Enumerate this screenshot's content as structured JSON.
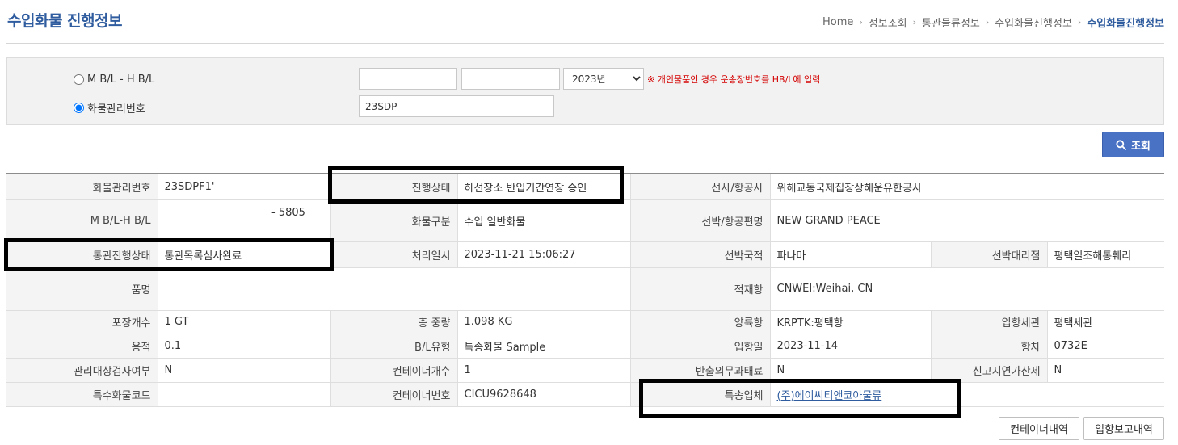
{
  "page": {
    "title": "수입화물 진행정보"
  },
  "breadcrumb": [
    "Home",
    "정보조회",
    "통관물류정보",
    "수입화물진행정보",
    "수입화물진행정보"
  ],
  "search": {
    "radio_mbl_label": "M B/L - H B/L",
    "radio_cargo_label": "화물관리번호",
    "selected": "cargo",
    "mbl_value": "",
    "hbl_value": "",
    "year_selected": "2023년",
    "year_options": [
      "2023년"
    ],
    "notice": "※ 개인물품인 경우 운송장번호를 HB/L에 입력",
    "cargo_value": "23SDP",
    "button_label": "조회"
  },
  "info": {
    "rows": [
      [
        {
          "label": "화물관리번호",
          "value": "23SDPF1'"
        },
        {
          "label": "진행상태",
          "value": "하선장소 반입기간연장 승인"
        },
        {
          "label": "선사/항공사",
          "value": "위해교동국제집장상해운유한공사"
        }
      ],
      [
        {
          "label": "M B/L-H B/L",
          "value": "- 5805"
        },
        {
          "label": "화물구분",
          "value": "수입 일반화물"
        },
        {
          "label": "선박/항공편명",
          "value": "NEW GRAND PEACE"
        }
      ],
      [
        {
          "label": "통관진행상태",
          "value": "통관목록심사완료"
        },
        {
          "label": "처리일시",
          "value": "2023-11-21 15:06:27"
        },
        {
          "label": "선박국적",
          "value": "파나마"
        },
        {
          "label": "선박대리점",
          "value": "평택일조해통훼리"
        }
      ],
      [
        {
          "label": "품명",
          "value": ""
        },
        {
          "label": "적재항",
          "value": "CNWEI:Weihai, CN"
        }
      ],
      [
        {
          "label": "포장개수",
          "value": "1 GT"
        },
        {
          "label": "총 중량",
          "value": "1.098 KG"
        },
        {
          "label": "양륙항",
          "value": "KRPTK:평택항"
        },
        {
          "label": "입항세관",
          "value": "평택세관"
        }
      ],
      [
        {
          "label": "용적",
          "value": "0.1"
        },
        {
          "label": "B/L유형",
          "value": "특송화물 Sample"
        },
        {
          "label": "입항일",
          "value": "2023-11-14"
        },
        {
          "label": "항차",
          "value": "0732E"
        }
      ],
      [
        {
          "label": "관리대상검사여부",
          "value": "N"
        },
        {
          "label": "컨테이너개수",
          "value": "1"
        },
        {
          "label": "반출의무과태료",
          "value": "N"
        },
        {
          "label": "신고지연가산세",
          "value": "N"
        }
      ],
      [
        {
          "label": "특수화물코드",
          "value": ""
        },
        {
          "label": "컨테이너번호",
          "value": "CICU9628648"
        },
        {
          "label": "특송업체",
          "value": "(주)에이씨티앤코아물류"
        }
      ]
    ]
  },
  "buttons": {
    "container_list": "컨테이너내역",
    "entry_report": "입항보고내역"
  },
  "colors": {
    "accent": "#2f5c9e",
    "button_blue": "#4a72c4",
    "notice_red": "#d40000",
    "label_bg": "#f4f4f4"
  }
}
